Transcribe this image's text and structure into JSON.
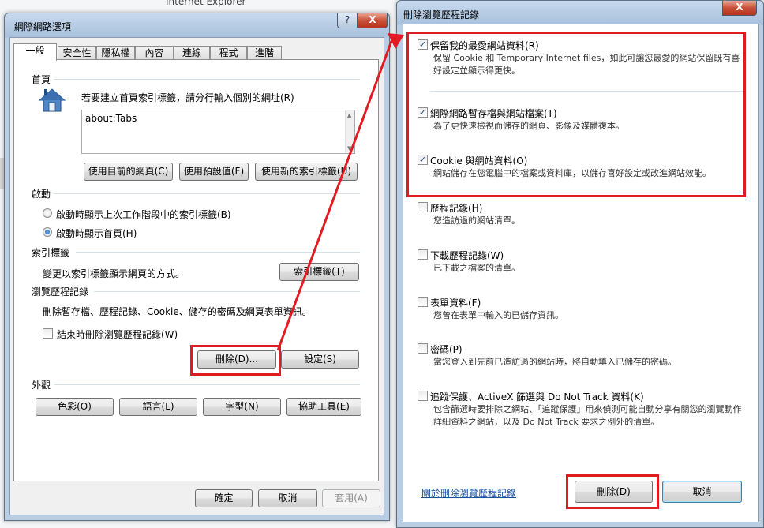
{
  "background": {
    "title_fragment": "Internet Explorer"
  },
  "internet_options": {
    "title": "網際網路選項",
    "help_button": "?",
    "close_button": "X",
    "tabs": [
      "一般",
      "安全性",
      "隱私權",
      "內容",
      "連線",
      "程式",
      "進階"
    ],
    "home_page": {
      "label": "首頁",
      "instruction": "若要建立首頁索引標籤，請分行輸入個別的網址(R)",
      "value": "about:Tabs",
      "buttons": [
        "使用目前的網頁(C)",
        "使用預設值(F)",
        "使用新的索引標籤(U)"
      ]
    },
    "startup": {
      "label": "啟動",
      "options": [
        "啟動時顯示上次工作階段中的索引標籤(B)",
        "啟動時顯示首頁(H)"
      ],
      "selected_index": 1
    },
    "tabs_section": {
      "label": "索引標籤",
      "description": "變更以索引標籤顯示網頁的方式。",
      "button": "索引標籤(T)"
    },
    "history": {
      "label": "瀏覽歷程記錄",
      "description": "刪除暫存檔、歷程記錄、Cookie、儲存的密碼及網頁表單資訊。",
      "checkbox": "結束時刪除瀏覽歷程記錄(W)",
      "checkbox_checked": false,
      "delete_button": "刪除(D)...",
      "settings_button": "設定(S)"
    },
    "appearance": {
      "label": "外觀",
      "buttons": [
        "色彩(O)",
        "語言(L)",
        "字型(N)",
        "協助工具(E)"
      ]
    },
    "footer": {
      "ok": "確定",
      "cancel": "取消",
      "apply": "套用(A)"
    }
  },
  "delete_history": {
    "title": "刪除瀏覽歷程記錄",
    "close_button": "X",
    "options": [
      {
        "title": "保留我的最愛網站資料(R)",
        "desc": "保留 Cookie 和 Temporary Internet files，如此可讓您最愛的網站保留既有喜好設定並顯示得更快。",
        "checked": true
      },
      {
        "title": "網際網路暫存檔與網站檔案(T)",
        "desc": "為了更快速檢視而儲存的網頁、影像及媒體複本。",
        "checked": true
      },
      {
        "title": "Cookie 與網站資料(O)",
        "desc": "網站儲存在您電腦中的檔案或資料庫，以儲存喜好設定或改進網站效能。",
        "checked": true
      },
      {
        "title": "歷程記錄(H)",
        "desc": "您造訪過的網站清單。",
        "checked": false
      },
      {
        "title": "下載歷程記錄(W)",
        "desc": "已下載之檔案的清單。",
        "checked": false
      },
      {
        "title": "表單資料(F)",
        "desc": "您曾在表單中輸入的已儲存資訊。",
        "checked": false
      },
      {
        "title": "密碼(P)",
        "desc": "當您登入到先前已造訪過的網站時，將自動填入已儲存的密碼。",
        "checked": false
      },
      {
        "title": "追蹤保護、ActiveX 篩選與 Do Not Track 資料(K)",
        "desc": "包含篩選時要排除之網站、「追蹤保護」用來偵測可能自動分享有關您的瀏覽動作詳細資料之網站，以及 Do Not Track 要求之例外的清單。",
        "checked": false
      }
    ],
    "about_link": "關於刪除瀏覽歷程記錄",
    "delete_button": "刪除(D)",
    "cancel_button": "取消"
  },
  "annotation_color": "#e21b23"
}
